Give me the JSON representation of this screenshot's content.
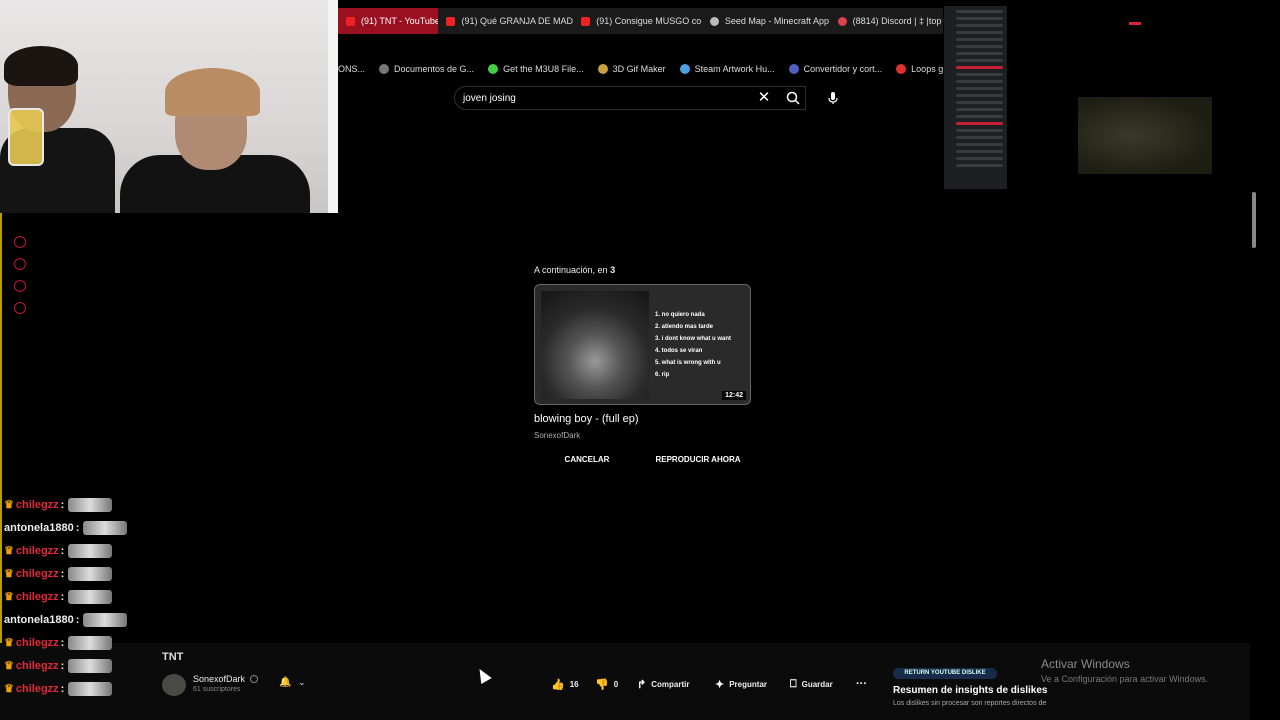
{
  "browser": {
    "tabs": [
      {
        "label": "(91) TNT - YouTube",
        "icon": "youtube-icon",
        "active": true
      },
      {
        "label": "(91) Qué GRANJA DE MAD",
        "icon": "youtube-icon"
      },
      {
        "label": "(91) Consigue MUSGO co",
        "icon": "youtube-icon"
      },
      {
        "label": "Seed Map - Minecraft App",
        "icon": "seedmap-icon"
      },
      {
        "label": "(8814) Discord | ‡ |top",
        "icon": "discord-icon"
      }
    ],
    "bookmarks": [
      {
        "label": "ONS..."
      },
      {
        "label": "Documentos de G..."
      },
      {
        "label": "Get the M3U8 File..."
      },
      {
        "label": "3D Gif Maker"
      },
      {
        "label": "Steam Artwork Hu..."
      },
      {
        "label": "Convertidor y cort..."
      },
      {
        "label": "Loops gratis: Sint"
      }
    ]
  },
  "search": {
    "query": "joven josing"
  },
  "up_next": {
    "label": "A continuación, en",
    "countdown": "3",
    "tracks": [
      "1. no quiero nada",
      "2. atiendo mas tarde",
      "3. i dont know what u want",
      "4. todos se viran",
      "5. what is wrong with u",
      "6. rip"
    ],
    "duration": "12:42",
    "title": "blowing boy - (full ep)",
    "channel": "SonexofDark",
    "cancel_label": "CANCELAR",
    "play_label": "REPRODUCIR AHORA"
  },
  "video": {
    "title": "TNT",
    "channel": "SonexofDark",
    "subscribers": "61 suscriptores",
    "likes": "16",
    "dislikes": "0",
    "share_label": "Compartir",
    "ask_label": "Preguntar",
    "save_label": "Guardar"
  },
  "ryd": {
    "badge": "RETURN YOUTUBE DISLIKE",
    "title": "Resumen de insights de dislikes",
    "text": "Los dislikes sin procesar son reportes directos de"
  },
  "windows": {
    "activate_title": "Activar Windows",
    "activate_sub": "Ve a Configuración para activar Windows."
  },
  "chat": [
    {
      "user": "chilegzz",
      "color": "#e22838",
      "crown": true
    },
    {
      "user": "antonela1880",
      "color": "#eeeeee",
      "crown": false
    },
    {
      "user": "chilegzz",
      "color": "#e22838",
      "crown": true
    },
    {
      "user": "chilegzz",
      "color": "#e22838",
      "crown": true
    },
    {
      "user": "chilegzz",
      "color": "#e22838",
      "crown": true
    },
    {
      "user": "antonela1880",
      "color": "#eeeeee",
      "crown": false
    },
    {
      "user": "chilegzz",
      "color": "#e22838",
      "crown": true
    },
    {
      "user": "chilegzz",
      "color": "#e22838",
      "crown": true
    },
    {
      "user": "chilegzz",
      "color": "#e22838",
      "crown": true
    }
  ],
  "colors": {
    "accent": "#c01630",
    "background": "#000000"
  }
}
